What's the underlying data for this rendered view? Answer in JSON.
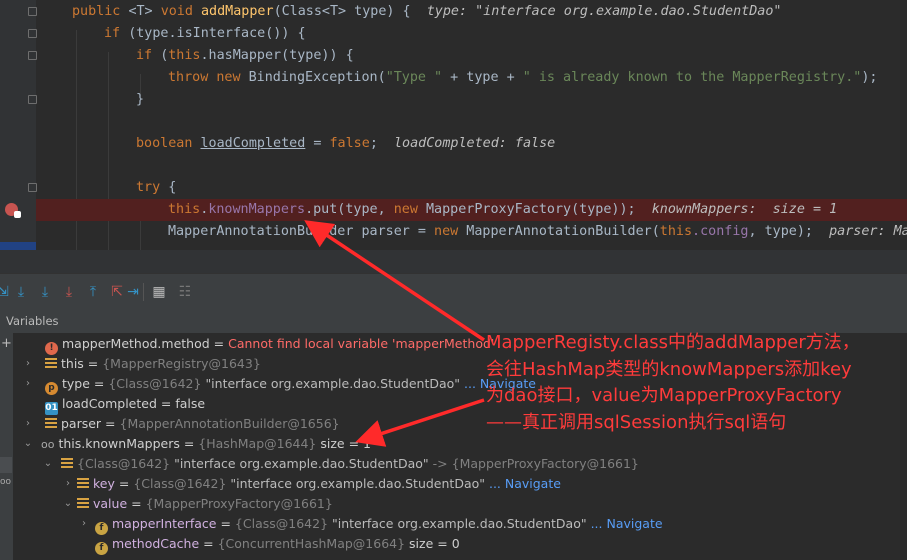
{
  "code": {
    "sig_public": "public ",
    "sig_generic": "<T> ",
    "sig_void": "void ",
    "sig_method": "addMapper",
    "sig_params": "(Class<T> type) {  ",
    "sig_hint": "type: \"interface org.example.dao.StudentDao\"",
    "if1_kw": "if ",
    "if1_rest": "(type.isInterface()) {",
    "if2_kw": "if ",
    "if2_open": "(",
    "if2_this": "this",
    "if2_rest": ".hasMapper(type)) {",
    "throw_kw": "throw new ",
    "throw_cls": "BindingException(",
    "throw_s1": "\"Type \"",
    "throw_mid": " + type + ",
    "throw_s2": "\" is already known to the MapperRegistry.\"",
    "throw_end": ");",
    "brace_close": "}",
    "bool_kw": "boolean ",
    "bool_var": "loadCompleted",
    "bool_eq": " = ",
    "bool_false": "false",
    "bool_semi": ";  ",
    "bool_hint": "loadCompleted: false",
    "try_kw": "try ",
    "try_brace": "{",
    "put_this": "this",
    "put_dot": ".",
    "put_field": "knownMappers",
    "put_call": ".put(type, ",
    "put_new": "new ",
    "put_rest": "MapperProxyFactory(type));  ",
    "put_hint": "knownMappers:  size = 1",
    "mab_start": "MapperAnnotationBuilder parser = ",
    "mab_new": "new ",
    "mab_cls": "MapperAnnotationBuilder(",
    "mab_this": "this",
    "mab_cfg": ".config",
    "mab_end": ", type);  ",
    "mab_hint": "parser: Mapp"
  },
  "panel": {
    "title": "Variables"
  },
  "vars": [
    {
      "name": "mapperMethod.method",
      "eq": " = ",
      "value": "Cannot find local variable 'mapperMethod'"
    },
    {
      "name": "this",
      "eq": " = ",
      "ref": "{MapperRegistry@1643}"
    },
    {
      "name": "type",
      "eq": " = ",
      "ref": "{Class@1642} ",
      "str": "\"interface org.example.dao.StudentDao\"",
      "nav": " ... Navigate"
    },
    {
      "name": "loadCompleted",
      "eq": " = ",
      "value": "false"
    },
    {
      "name": "parser",
      "eq": " = ",
      "ref": "{MapperAnnotationBuilder@1656}"
    },
    {
      "name": "this.knownMappers",
      "eq": " = ",
      "ref": "{HashMap@1644} ",
      "extra": " size = 1"
    },
    {
      "ref": "{Class@1642} ",
      "str": "\"interface org.example.dao.StudentDao\"",
      "arrow": " -> ",
      "ref2": "{MapperProxyFactory@1661}"
    },
    {
      "name": "key",
      "eq": " = ",
      "ref": "{Class@1642} ",
      "str": "\"interface org.example.dao.StudentDao\"",
      "nav": " ... Navigate"
    },
    {
      "name": "value",
      "eq": " = ",
      "ref": "{MapperProxyFactory@1661}"
    },
    {
      "name": "mapperInterface",
      "eq": " = ",
      "ref": "{Class@1642} ",
      "str": "\"interface org.example.dao.StudentDao\"",
      "nav": " ... Navigate"
    },
    {
      "name": "methodCache",
      "eq": " = ",
      "ref": "{ConcurrentHashMap@1664} ",
      "extra": " size = 0"
    }
  ],
  "annotation": {
    "line1": "MapperRegisty.class中的addMapper方法，",
    "line2": "会往HashMap类型的knowMappers添加key",
    "line3": "为dao接口，value为MapperProxyFactory",
    "line4": "——真正调用sqlSession执行sql语句"
  },
  "colors": {
    "annotation_red": "#ff3b3b",
    "breakpoint_line": "#52201f"
  }
}
